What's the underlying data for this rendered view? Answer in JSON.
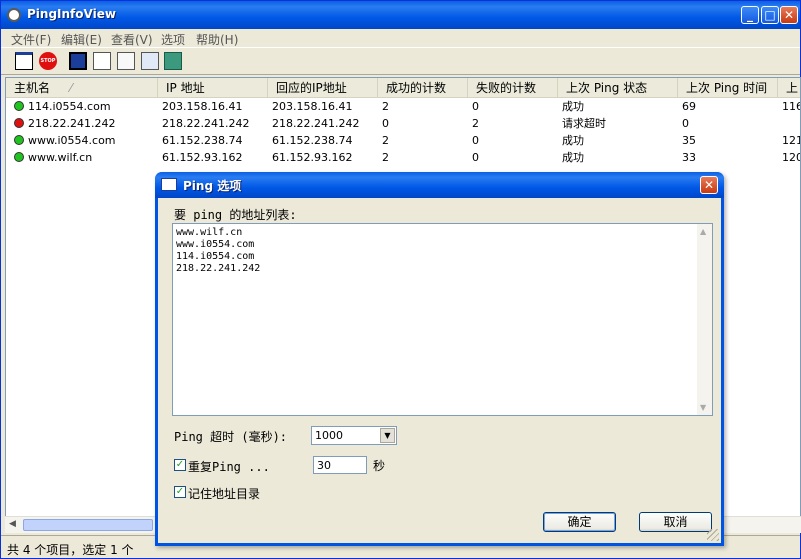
{
  "window": {
    "title": "PingInfoView"
  },
  "menu": [
    "文件(F)",
    "编辑(E)",
    "查看(V)",
    "选项",
    "帮助(H)"
  ],
  "listview": {
    "columns": [
      "主机名",
      "IP 地址",
      "回应的IP地址",
      "成功的计数",
      "失败的计数",
      "上次 Ping 状态",
      "上次 Ping 时间",
      "上"
    ],
    "rows": [
      {
        "status": "green",
        "host": "114.i0554.com",
        "ip": "203.158.16.41",
        "reply_ip": "203.158.16.41",
        "succ": "2",
        "fail": "0",
        "last_status": "成功",
        "last_time": "69",
        "extra": "116"
      },
      {
        "status": "red",
        "host": "218.22.241.242",
        "ip": "218.22.241.242",
        "reply_ip": "218.22.241.242",
        "succ": "0",
        "fail": "2",
        "last_status": "请求超时",
        "last_time": "0",
        "extra": ""
      },
      {
        "status": "green",
        "host": "www.i0554.com",
        "ip": "61.152.238.74",
        "reply_ip": "61.152.238.74",
        "succ": "2",
        "fail": "0",
        "last_status": "成功",
        "last_time": "35",
        "extra": "121"
      },
      {
        "status": "green",
        "host": "www.wilf.cn",
        "ip": "61.152.93.162",
        "reply_ip": "61.152.93.162",
        "succ": "2",
        "fail": "0",
        "last_status": "成功",
        "last_time": "33",
        "extra": "120"
      }
    ]
  },
  "status": {
    "text": "共 4 个项目，选定 1 个"
  },
  "dialog": {
    "title": "Ping 选项",
    "list_label": "要 ping 的地址列表:",
    "addresses": "www.wilf.cn\nwww.i0554.com\n114.i0554.com\n218.22.241.242",
    "timeout_label": "Ping 超时 (毫秒):",
    "timeout_value": "1000",
    "repeat_label": "重复Ping ...",
    "repeat_value": "30",
    "repeat_unit": "秒",
    "remember_label": "记住地址目录",
    "ok": "确定",
    "cancel": "取消"
  },
  "colors": {
    "green": "#1fc41f",
    "red": "#e01010",
    "titlebar": "#0058e6"
  }
}
